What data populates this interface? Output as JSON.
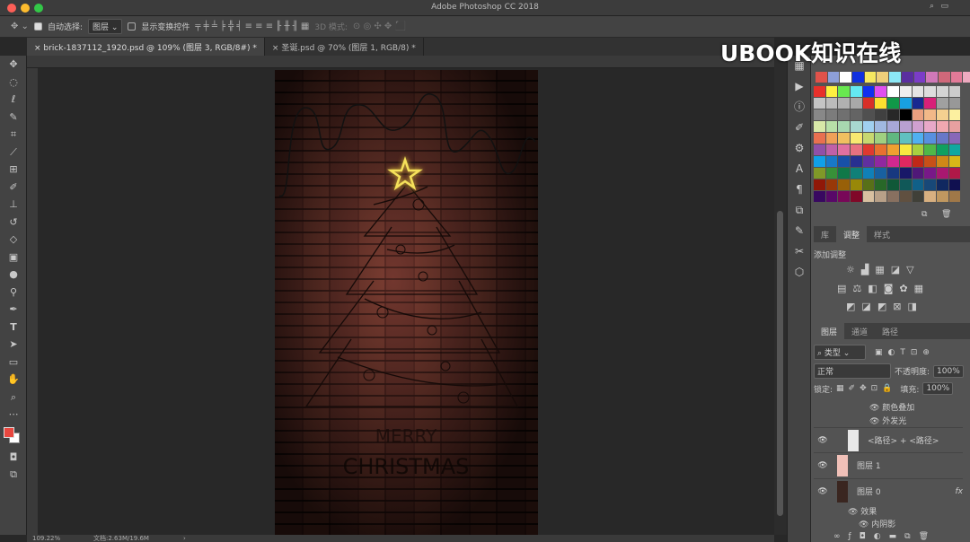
{
  "window": {
    "title": "Adobe Photoshop CC 2018"
  },
  "options": {
    "auto_select_label": "自动选择:",
    "auto_select_target": "图层",
    "show_transform_label": "显示变换控件",
    "mode_3d": "3D 模式:"
  },
  "tabs": [
    {
      "label": "brick-1837112_1920.psd @ 109% (图层 3, RGB/8#) *"
    },
    {
      "label": "圣诞.psd @ 70% (图层 1, RGB/8) *"
    }
  ],
  "watermark": "UBOOK知识在线",
  "tools": [
    "move",
    "marquee",
    "lasso",
    "quick-select",
    "crop",
    "eyedropper",
    "healing",
    "brush",
    "stamp",
    "history-brush",
    "eraser",
    "gradient",
    "blur",
    "dodge",
    "pen",
    "type",
    "path-select",
    "rectangle",
    "hand",
    "zoom",
    "more"
  ],
  "colors": {
    "foreground": "#e8473f",
    "background": "#ffffff",
    "star": "#f5e15a"
  },
  "swatches": {
    "recent": [
      "#e0524a",
      "#8d9fd8",
      "#ffffff",
      "#1030e0",
      "#f6e860",
      "#eecf7a",
      "#8ce8f6",
      "#5a2ea0",
      "#7b3cc8",
      "#d078b8",
      "#d0687a",
      "#e27a98",
      "#eeaac0"
    ],
    "grid": [
      "#e8302a",
      "#fdf040",
      "#68e850",
      "#64e8f2",
      "#1030f0",
      "#e050f0",
      "#ffffff",
      "#eeeeee",
      "#e4e4e4",
      "#dddddd",
      "#d4d4d4",
      "#cccccc",
      "#c4c4c4",
      "#bbbbbb",
      "#b0b0b0",
      "#a8a8a8",
      "#d83028",
      "#fde030",
      "#109848",
      "#18a0e0",
      "#182890",
      "#d82078",
      "#a0a0a0",
      "#989898",
      "#888888",
      "#7c7c7c",
      "#707070",
      "#646464",
      "#505050",
      "#404040",
      "#282828",
      "#000000",
      "#eaa080",
      "#f2b888",
      "#f4d090",
      "#fcf0a0",
      "#d8e8a8",
      "#b8e0a8",
      "#a8d8b0",
      "#a8d8d0",
      "#a0d0f0",
      "#a0b8e0",
      "#a8a8d8",
      "#b8a0d0",
      "#d0a0d0",
      "#e8a8c8",
      "#f0a8b0",
      "#e8a0a0",
      "#e87050",
      "#f0a058",
      "#f0c060",
      "#f8e870",
      "#c8d870",
      "#a0d080",
      "#60b880",
      "#60c0c0",
      "#50b0f0",
      "#5890e0",
      "#6878c8",
      "#8868b8",
      "#9050a8",
      "#c060a8",
      "#e070a0",
      "#e87080",
      "#e03830",
      "#e87030",
      "#f0a030",
      "#f8e840",
      "#a8d040",
      "#50b848",
      "#10a060",
      "#10a8a0",
      "#10a0e8",
      "#1878c8",
      "#1850a8",
      "#283090",
      "#6030a0",
      "#9028a0",
      "#d02890",
      "#e02860",
      "#c02818",
      "#c85018",
      "#d08818",
      "#d8b818",
      "#809828",
      "#389038",
      "#107848",
      "#108078",
      "#1080b8",
      "#1860a0",
      "#183880",
      "#181868",
      "#501878",
      "#781888",
      "#a81870",
      "#b01848",
      "#901808",
      "#983808",
      "#986008",
      "#988808",
      "#587018",
      "#286828",
      "#105838",
      "#105858",
      "#106088",
      "#184878",
      "#102860",
      "#101050",
      "#380860",
      "#580868",
      "#780858",
      "#800828",
      "#d8c0a0",
      "#b8a088",
      "#887060",
      "#605040",
      "#404038",
      "#d8b080",
      "#c09860",
      "#a07848"
    ]
  },
  "adjust_panel": {
    "tabs": [
      "库",
      "调整",
      "样式"
    ],
    "active": 1,
    "title": "添加调整"
  },
  "layers_panel": {
    "tabs": [
      "图层",
      "通道",
      "路径"
    ],
    "active": 0,
    "filter": "类型",
    "blend_mode": "正常",
    "opacity_label": "不透明度:",
    "opacity": "100%",
    "lock_label": "锁定:",
    "fill_label": "填充:",
    "fill": "100%",
    "effects_top": [
      "颜色叠加",
      "外发光"
    ],
    "layers": [
      {
        "name": "<路径> + <路径>"
      },
      {
        "name": "图层 1"
      },
      {
        "name": "图层 0",
        "fx": "fx"
      }
    ],
    "effects_bottom": {
      "group": "效果",
      "item": "内阴影"
    }
  },
  "status": {
    "zoom": "109.22%",
    "doc": "文档:2.63M/19.6M"
  }
}
